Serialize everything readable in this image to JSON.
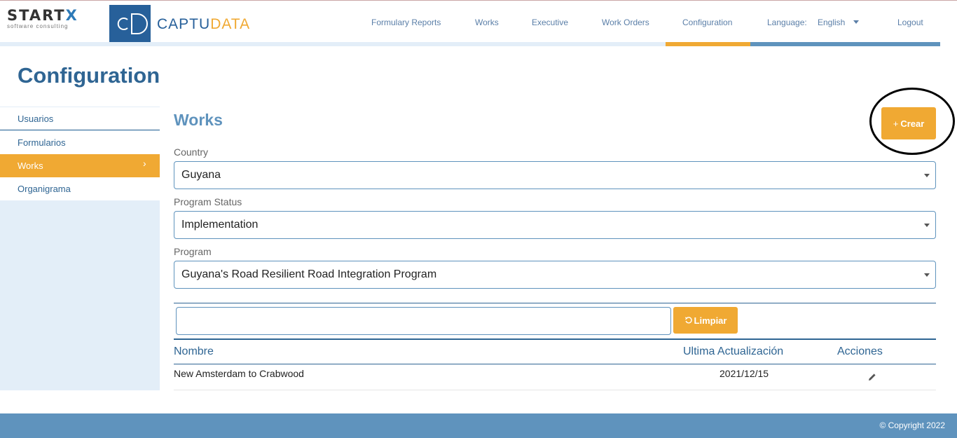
{
  "brand": {
    "startx_text": "START",
    "startx_x": "X",
    "startx_sub": "software consulting",
    "cd_text": "cD",
    "captu": "CAPTU",
    "data": "DATA"
  },
  "nav": {
    "items": [
      "Formulary Reports",
      "Works",
      "Executive",
      "Work Orders",
      "Configuration"
    ],
    "language_label": "Language:",
    "language_value": "English",
    "logout": "Logout"
  },
  "page": {
    "title": "Configuration"
  },
  "sidebar": {
    "items": [
      {
        "label": "Usuarios"
      },
      {
        "label": "Formularios"
      },
      {
        "label": "Works"
      },
      {
        "label": "Organigrama"
      }
    ],
    "active_chevron": "›"
  },
  "main": {
    "section_title": "Works",
    "crear_plus": "+",
    "crear_label": "Crear",
    "country_label": "Country",
    "country_value": "Guyana",
    "status_label": "Program Status",
    "status_value": "Implementation",
    "program_label": "Program",
    "program_value": "Guyana's Road Resilient Road Integration Program",
    "search_value": "",
    "limpiar_label": "Limpiar"
  },
  "table": {
    "headers": [
      "Nombre",
      "Ultima Actualización",
      "Acciones"
    ],
    "rows": [
      {
        "nombre": "New Amsterdam to Crabwood",
        "fecha": "2021/12/15"
      }
    ]
  },
  "footer": {
    "copyright": "© Copyright 2022"
  },
  "colors": {
    "accent_orange": "#f0a933",
    "brand_blue": "#2f6593",
    "light_blue": "#5f93bd",
    "sidebar_bg": "#e3eef8"
  }
}
